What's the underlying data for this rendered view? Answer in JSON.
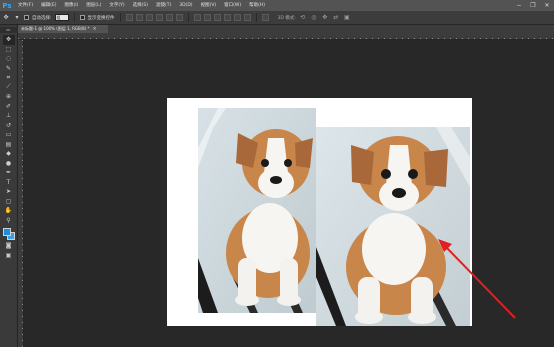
{
  "app": {
    "logo": "Ps"
  },
  "menu": [
    "文件(F)",
    "编辑(E)",
    "图像(I)",
    "图层(L)",
    "文字(Y)",
    "选择(S)",
    "滤镜(T)",
    "3D(D)",
    "视图(V)",
    "窗口(W)",
    "帮助(H)"
  ],
  "window_controls": {
    "minimize": "−",
    "restore": "❐",
    "close": "✕"
  },
  "options": {
    "move_icon": "move-tool-icon",
    "auto_select_label": "自动选择:",
    "auto_select_value": "组",
    "show_transform_label": "显示变换控件",
    "mode3d_label": "3D 模式:"
  },
  "document": {
    "tab_label": "未标题-1 @ 100% (图层 1, RGB/8) *",
    "close_glyph": "×"
  },
  "toolbar": {
    "collapse_glyph": "▸▸"
  },
  "tools": [
    {
      "name": "move-tool",
      "icon": "✥"
    },
    {
      "name": "marquee-tool",
      "icon": "⬚"
    },
    {
      "name": "lasso-tool",
      "icon": "◌"
    },
    {
      "name": "quick-select-tool",
      "icon": "✎"
    },
    {
      "name": "crop-tool",
      "icon": "⌗"
    },
    {
      "name": "eyedropper-tool",
      "icon": "⟋"
    },
    {
      "name": "healing-brush-tool",
      "icon": "⊕"
    },
    {
      "name": "brush-tool",
      "icon": "✐"
    },
    {
      "name": "clone-stamp-tool",
      "icon": "⊥"
    },
    {
      "name": "history-brush-tool",
      "icon": "↺"
    },
    {
      "name": "eraser-tool",
      "icon": "▭"
    },
    {
      "name": "gradient-tool",
      "icon": "▤"
    },
    {
      "name": "blur-tool",
      "icon": "◆"
    },
    {
      "name": "dodge-tool",
      "icon": "●"
    },
    {
      "name": "pen-tool",
      "icon": "✒"
    },
    {
      "name": "type-tool",
      "icon": "T"
    },
    {
      "name": "path-select-tool",
      "icon": "➤"
    },
    {
      "name": "shape-tool",
      "icon": "▢"
    },
    {
      "name": "hand-tool",
      "icon": "✋"
    },
    {
      "name": "zoom-tool",
      "icon": "⚲"
    }
  ],
  "colors": {
    "foreground": "#1a8fe0",
    "background": "#3aa0ec",
    "arrow": "#e02020",
    "canvas": "#ffffff",
    "workspace": "#282828"
  },
  "extra_tools": [
    {
      "name": "quick-mask-tool",
      "icon": "◙"
    },
    {
      "name": "screen-mode-tool",
      "icon": "▣"
    }
  ]
}
